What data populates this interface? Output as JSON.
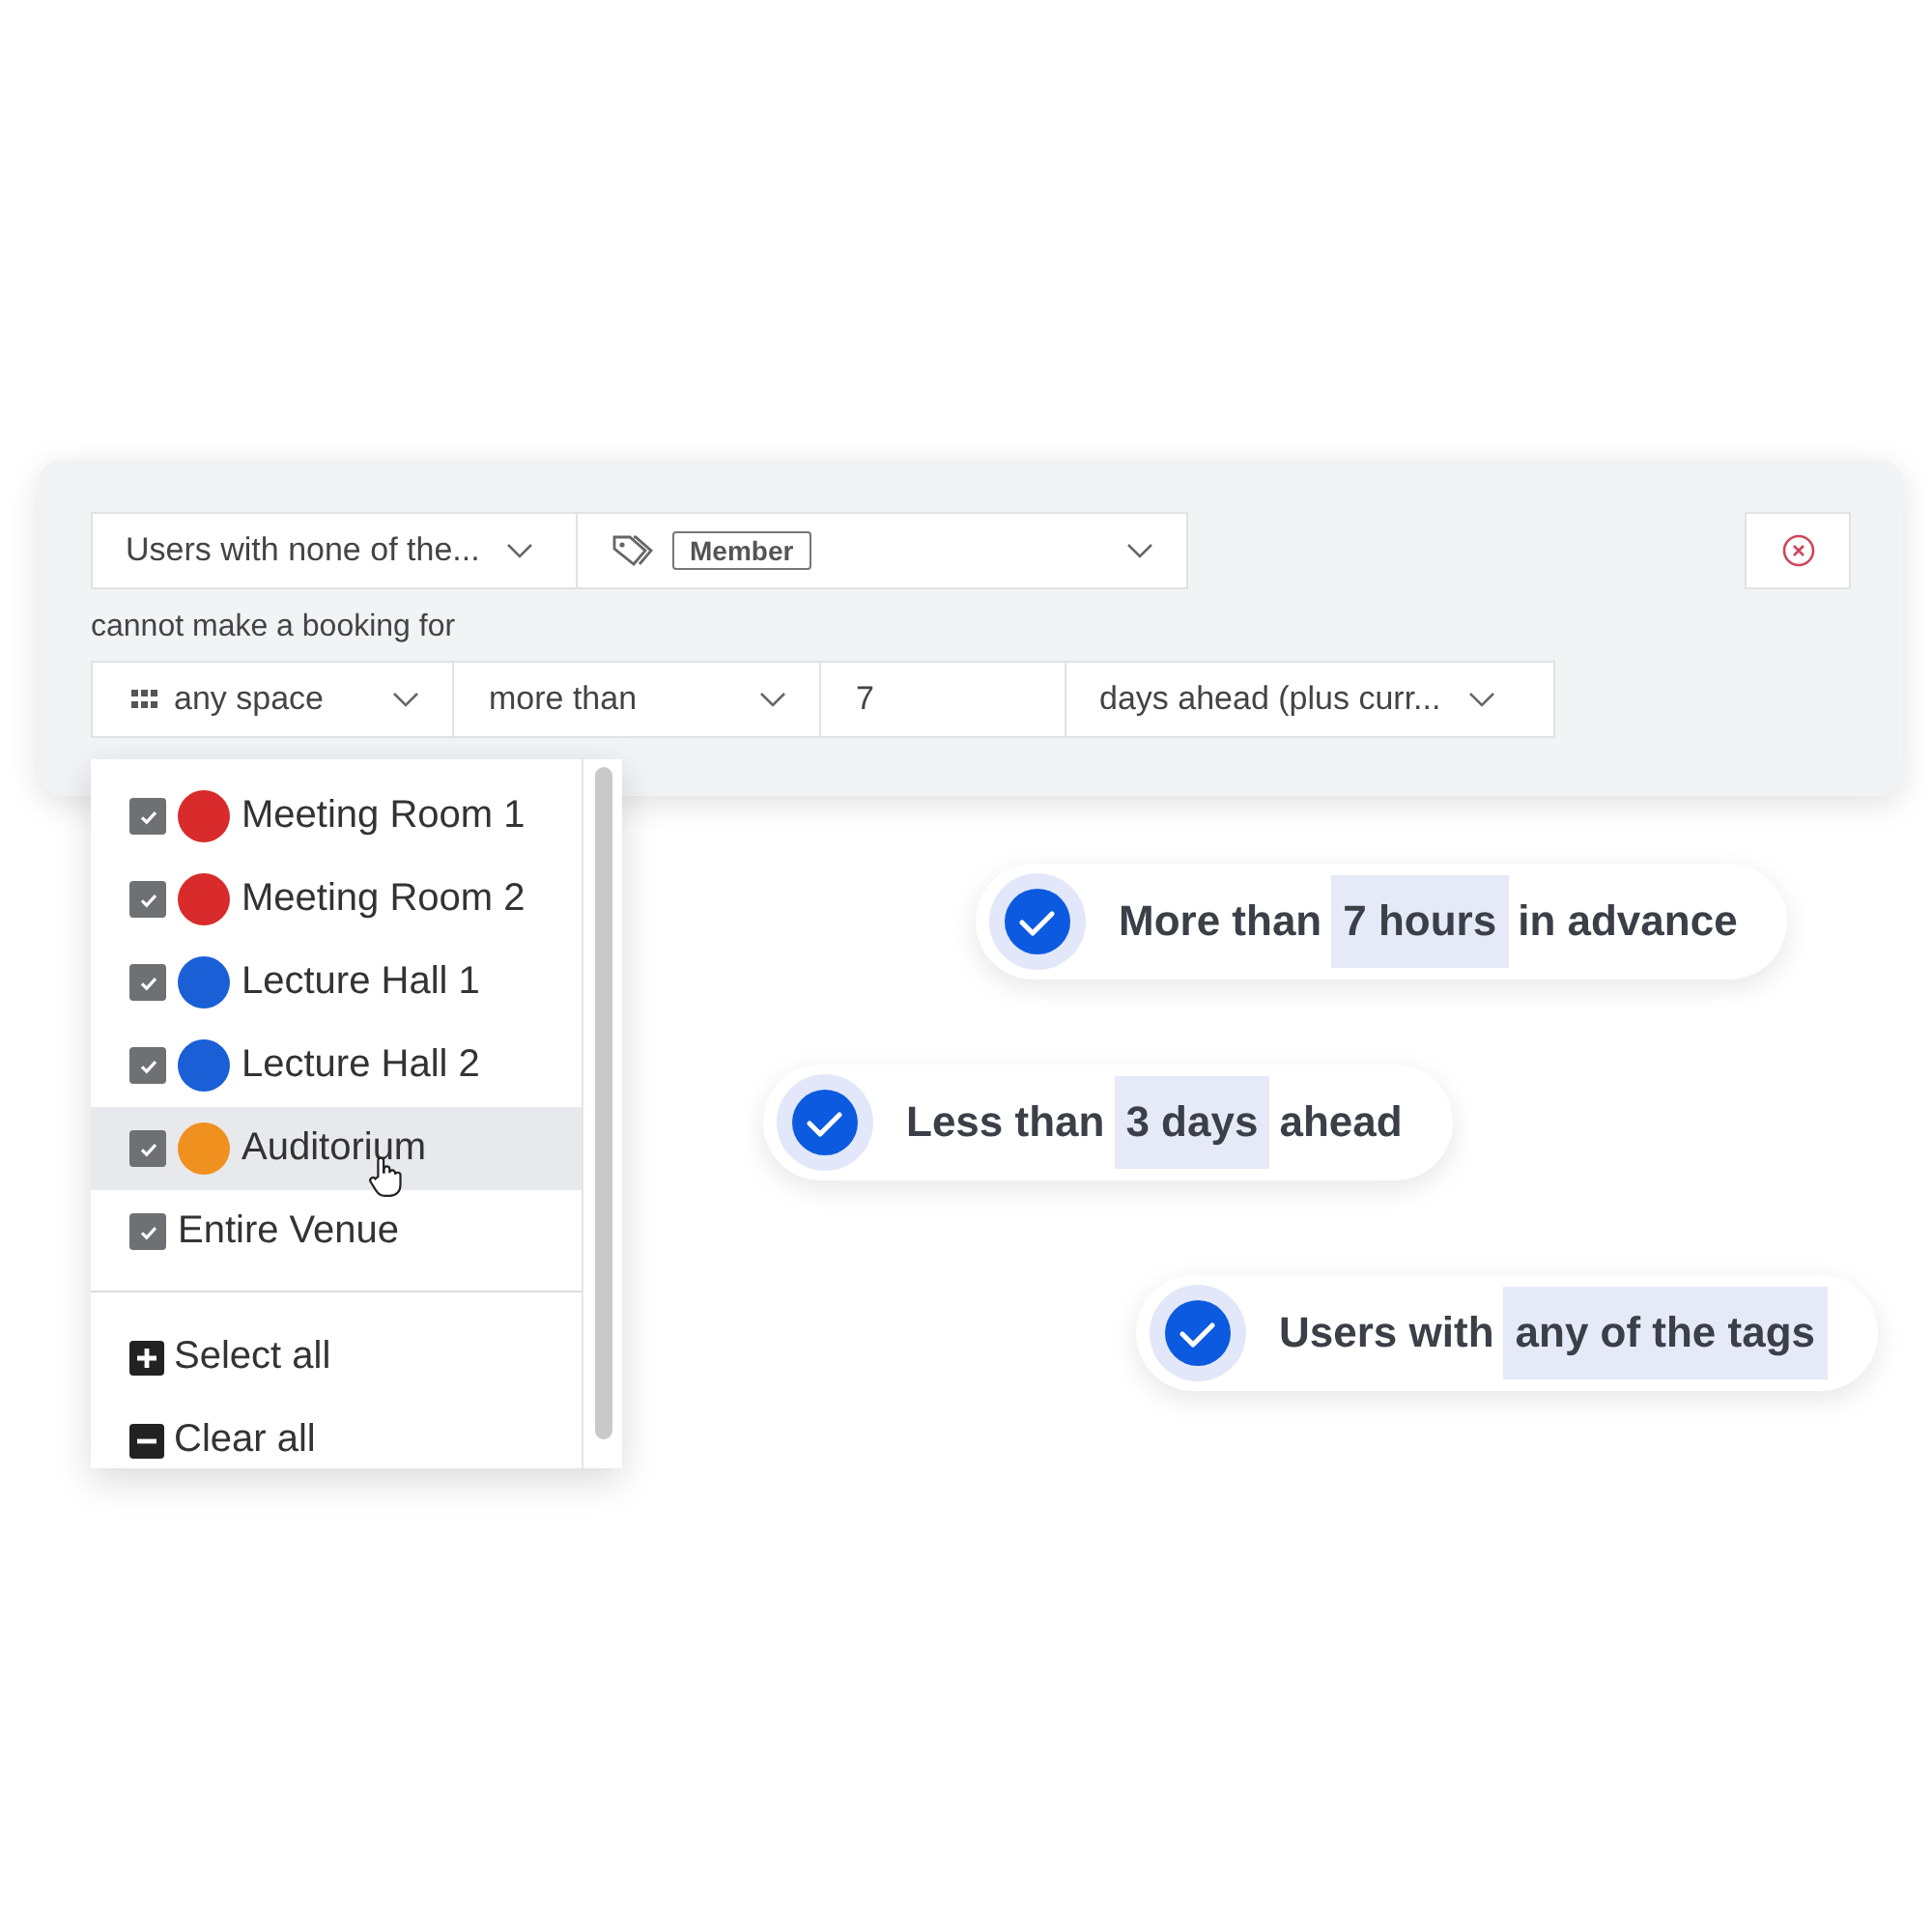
{
  "rule": {
    "user_select": {
      "value": "Users with none of the..."
    },
    "tag_field": {
      "tags": [
        "Member"
      ]
    },
    "label": "cannot make a booking for",
    "space_select": {
      "value": "any space"
    },
    "comparison_select": {
      "value": "more than"
    },
    "amount_field": {
      "value": "7"
    },
    "unit_select": {
      "value": "days ahead (plus curr..."
    }
  },
  "dropdown": {
    "items": [
      {
        "label": "Meeting Room 1",
        "checked": true,
        "selected": false,
        "color": "#d92b2b"
      },
      {
        "label": "Meeting Room 2",
        "checked": true,
        "selected": false,
        "color": "#d92b2b"
      },
      {
        "label": "Lecture Hall 1",
        "checked": true,
        "selected": false,
        "color": "#1a5fd6"
      },
      {
        "label": "Lecture Hall 2",
        "checked": true,
        "selected": false,
        "color": "#1a5fd6"
      },
      {
        "label": "Auditorium",
        "checked": true,
        "selected": true,
        "color": "#f0901e"
      },
      {
        "label": "Entire Venue",
        "checked": true,
        "selected": false
      }
    ],
    "actions": [
      {
        "kind": "add",
        "label": "Select all"
      },
      {
        "kind": "remove",
        "label": "Clear all"
      }
    ]
  },
  "conditions": [
    {
      "before": "More than",
      "highlight": "7 hours",
      "after": "in advance"
    },
    {
      "before": "Less than",
      "highlight": "3 days",
      "after": "ahead"
    },
    {
      "before": "Users with",
      "highlight": "any of the tags"
    }
  ]
}
